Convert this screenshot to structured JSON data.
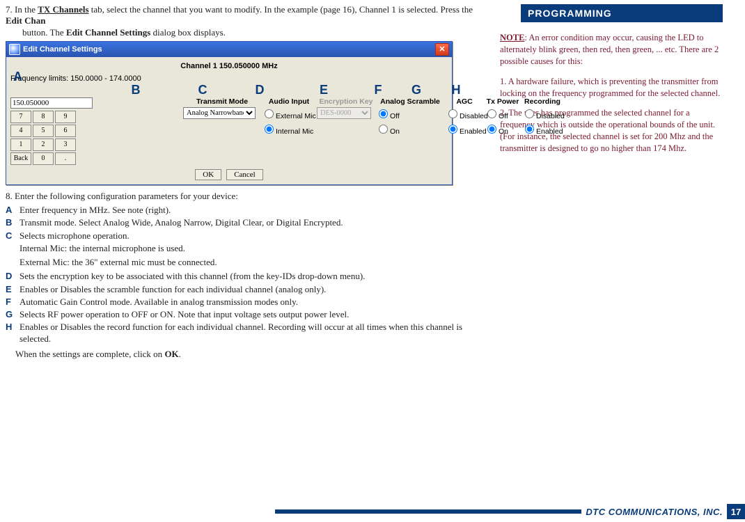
{
  "header": {
    "section_title": "PROGRAMMING"
  },
  "step7": {
    "lead": "7. In the ",
    "tab_label": "TX Channels",
    "mid1": " tab, select the channel that you want to modify. In the example (page 16), Channel 1 is selected. Press the ",
    "btn_label": "Edit Chan",
    "mid2": " button. The ",
    "dlg_label": "Edit Channel Settings",
    "tail": " dialog box displays."
  },
  "dialog": {
    "title": "Edit Channel Settings",
    "channel_line": "Channel  1    150.050000 MHz",
    "letters": {
      "A": "A",
      "B": "B",
      "C": "C",
      "D": "D",
      "E": "E",
      "F": "F",
      "G": "G",
      "H": "H"
    },
    "freq_limits": "Frequency limits: 150.0000 - 174.0000",
    "freq_value": "150.050000",
    "keypad": [
      "7",
      "8",
      "9",
      "4",
      "5",
      "6",
      "1",
      "2",
      "3",
      "Back",
      "0",
      "."
    ],
    "cols": {
      "txmode": "Transmit Mode",
      "audio": "Audio Input",
      "enc": "Encryption Key",
      "scramble": "Analog Scramble",
      "agc": "AGC",
      "txp": "Tx Power",
      "rec": "Recording"
    },
    "txmode_value": "Analog Narrowband",
    "audio_ext": "External Mic",
    "audio_int": "Internal Mic",
    "enc_value": "DES-0000",
    "off": "Off",
    "on": "On",
    "disabled": "Disabled",
    "enabled": "Enabled",
    "ok": "OK",
    "cancel": "Cancel"
  },
  "step8": "8. Enter the following configuration parameters for your device:",
  "items": {
    "A": "Enter frequency in MHz. See note (right).",
    "B": "Transmit mode. Select Analog Wide, Analog Narrow, Digital Clear, or Digital Encrypted.",
    "C": "Selects microphone operation.",
    "C_sub1": "Internal Mic: the internal microphone is used.",
    "C_sub2": "External Mic: the 36\" external mic must be connected.",
    "D": "Sets the encryption key to be associated with this channel (from the key-IDs drop-down menu).",
    "E": "Enables or Disables the scramble function for each individual channel (analog only).",
    "F": "Automatic Gain Control mode. Available in analog transmission modes only.",
    "G": "Selects RF power operation to OFF or ON. Note that input voltage sets output power level.",
    "H": "Enables or Disables the record function for each individual channel. Recording will occur at all times when this channel is selected."
  },
  "final_lead": "When the settings are complete, click on ",
  "final_btn": "OK",
  "final_tail": ".",
  "note": {
    "head": "NOTE",
    "p1": ": An error condition may occur, causing the LED to alternately blink green, then red, then green, ... etc. There are 2 possible causes for this:",
    "p2": "1. A hardware failure, which is preventing the transmitter from locking on the frequency programmed for the selected channel.",
    "p3": "2. The user has programmed the selected channel for a frequency which is outside the operational bounds of the unit. (For instance, the selected channel is set for 200 Mhz and the transmitter is designed to go no higher than 174 Mhz."
  },
  "footer": {
    "company": "DTC COMMUNICATIONS, INC.",
    "page": "17"
  }
}
